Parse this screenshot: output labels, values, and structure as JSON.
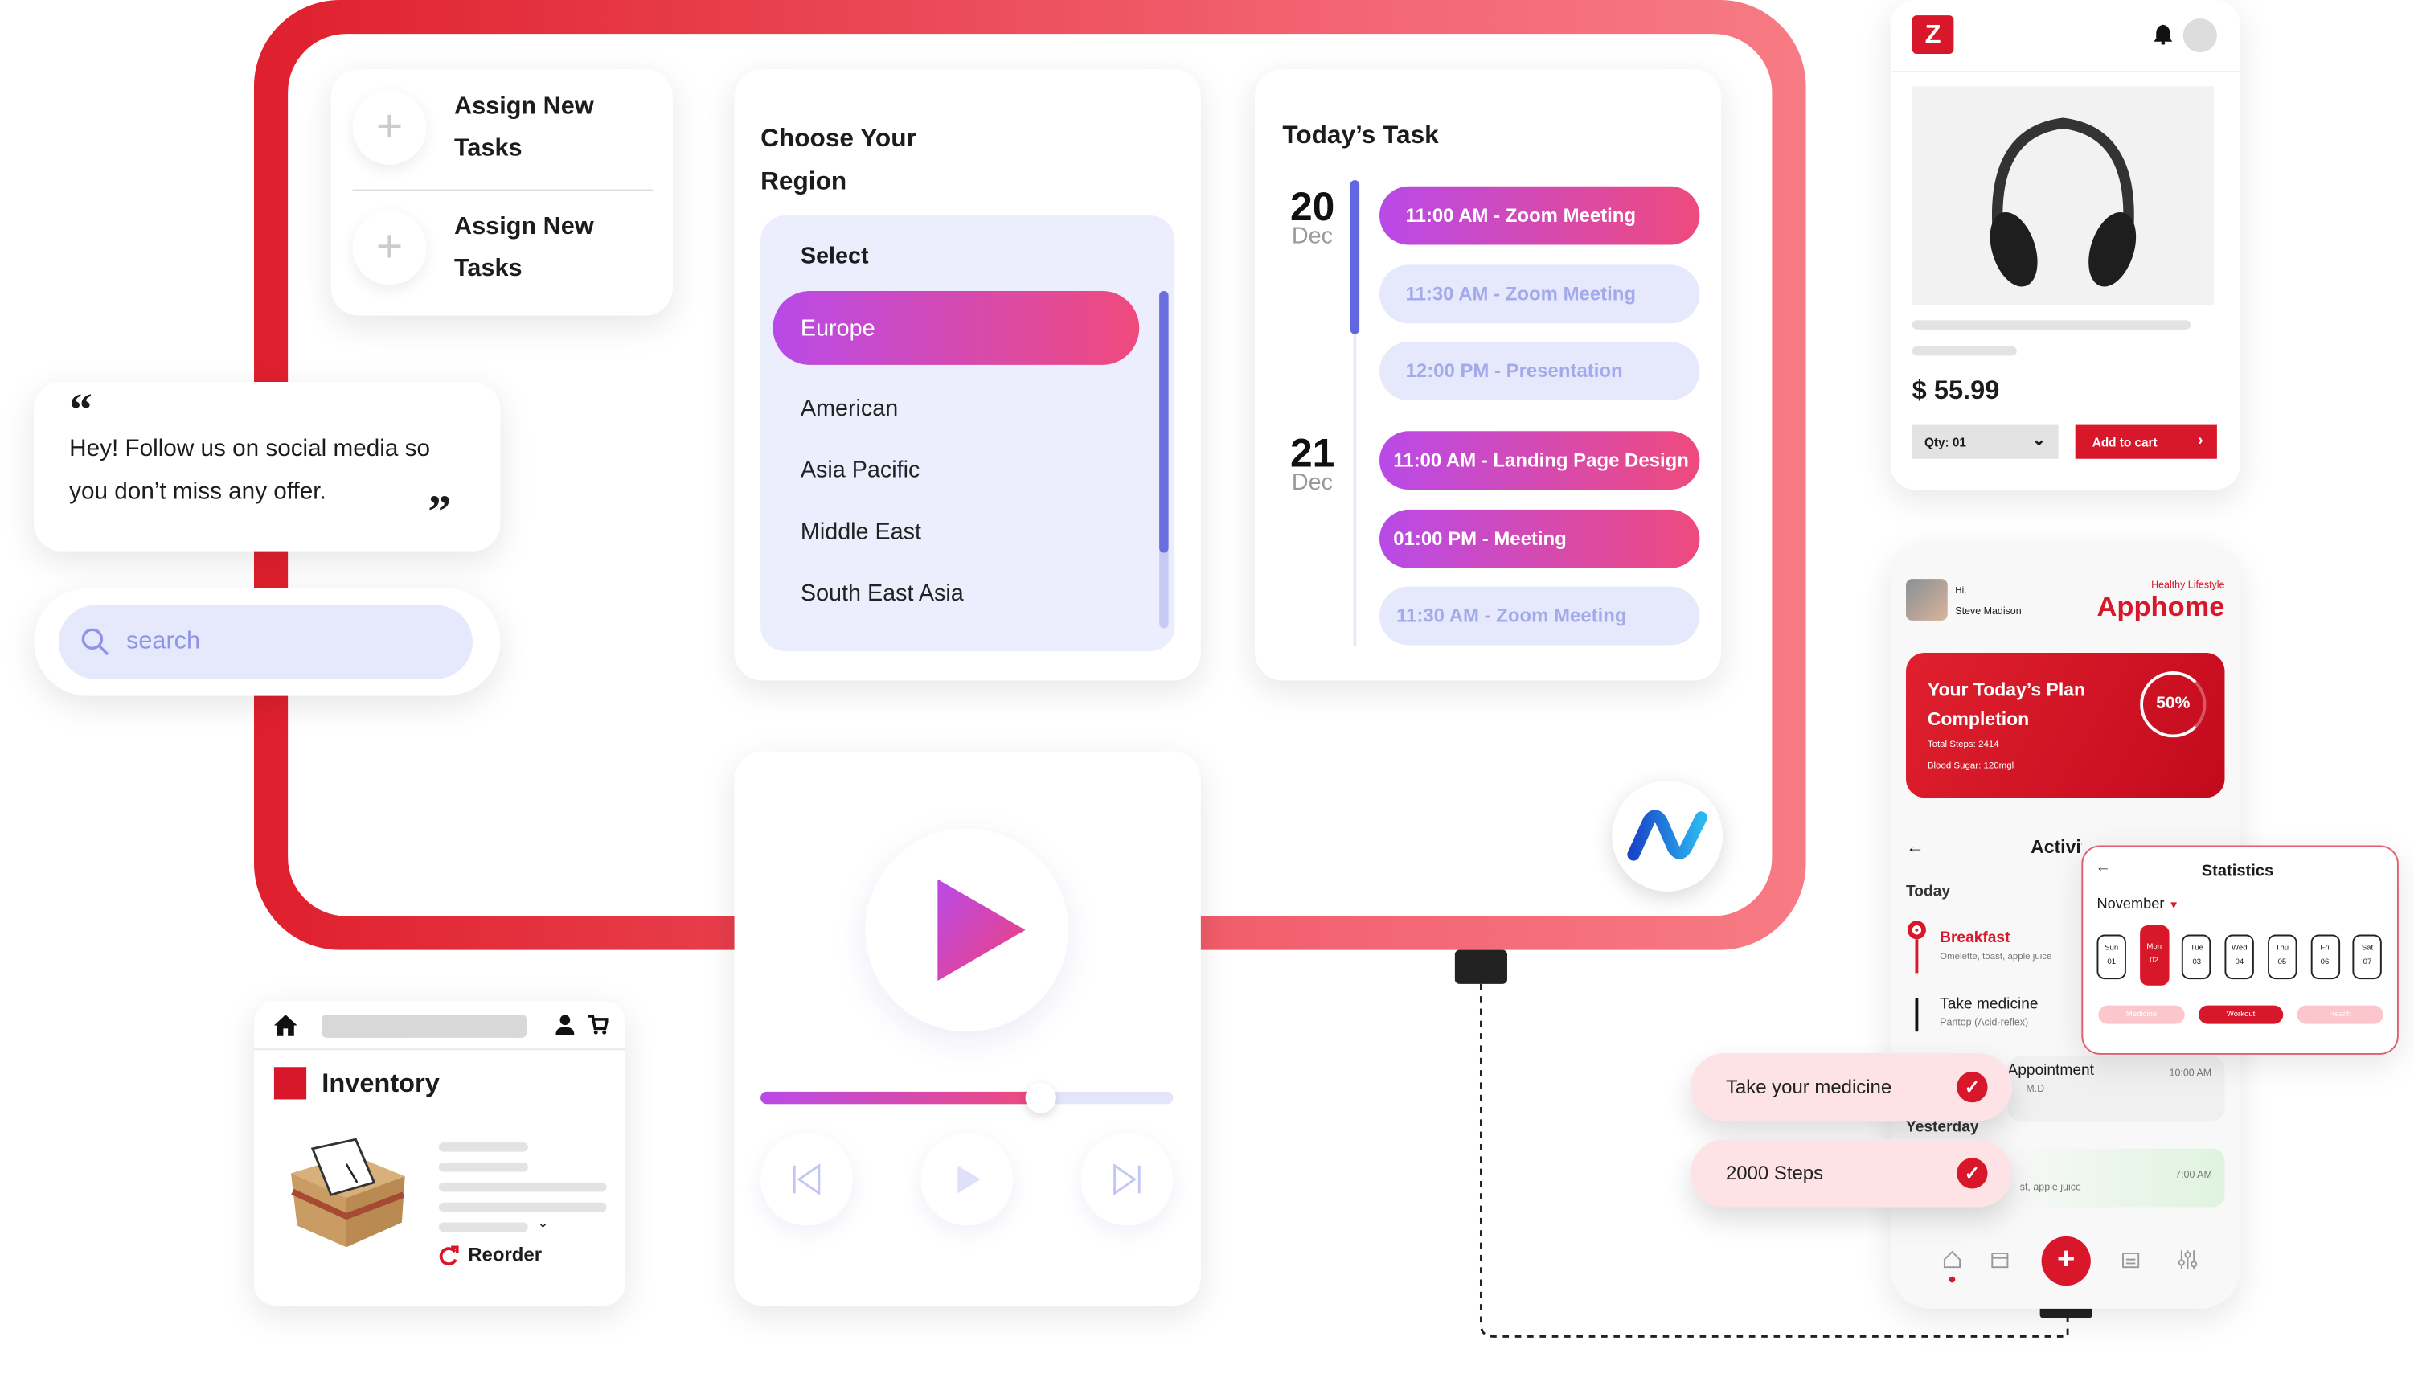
{
  "colors": {
    "brand_red": "#d9172a",
    "accent_purple": "#b94ae8",
    "accent_pink": "#ef4a7c",
    "indigo": "#6b6ee0",
    "lavender": "#e6e9fb"
  },
  "assign": {
    "items": [
      {
        "icon": "plus-icon",
        "label": "Assign New Tasks"
      },
      {
        "icon": "plus-icon",
        "label": "Assign New Tasks"
      }
    ]
  },
  "quote": {
    "open": "“",
    "text": "Hey! Follow us on social media so you don’t miss any offer.",
    "close": "”"
  },
  "search": {
    "placeholder": "search",
    "icon": "search-icon"
  },
  "region": {
    "title": "Choose Your Region",
    "header": "Select",
    "selected": "Europe",
    "options": [
      "American",
      "Asia Pacific",
      "Middle East",
      "South East Asia"
    ]
  },
  "tasks": {
    "title": "Today’s Task",
    "days": [
      {
        "day": "20",
        "month": "Dec",
        "items": [
          {
            "label": "11:00 AM - Zoom Meeting",
            "active": true
          },
          {
            "label": "11:30 AM - Zoom Meeting",
            "active": false
          },
          {
            "label": "12:00 PM - Presentation",
            "active": false
          }
        ]
      },
      {
        "day": "21",
        "month": "Dec",
        "items": [
          {
            "label": "11:00 AM - Landing Page Design",
            "active": true
          },
          {
            "label": "01:00 PM - Meeting",
            "active": true
          },
          {
            "label": "11:30 AM - Zoom Meeting",
            "active": false
          }
        ]
      }
    ]
  },
  "player": {
    "progress_percent": 68,
    "icons": [
      "play-icon",
      "previous-icon",
      "play-icon",
      "next-icon"
    ]
  },
  "inventory": {
    "title": "Inventory",
    "reorder": "Reorder",
    "icons": [
      "home-icon",
      "user-icon",
      "cart-icon",
      "reorder-icon"
    ]
  },
  "shop": {
    "logo": "Z",
    "price": "$ 55.99",
    "qty": "Qty: 01",
    "add_to_cart": "Add to cart"
  },
  "health": {
    "greeting": "Hi,",
    "user": "Steve Madison",
    "tagline": "Healthy Lifestyle",
    "brand": "Apphome",
    "plan": {
      "title": "Your Today’s Plan Completion",
      "percent": "50%",
      "steps": "Total Steps: 2414",
      "sugar": "Blood Sugar: 120mgl"
    },
    "activity_title": "Activity",
    "today": "Today",
    "yesterday": "Yesterday",
    "items": [
      {
        "title": "Breakfast",
        "sub": "Omelette, toast, apple juice"
      },
      {
        "title": "Take medicine",
        "sub": "Pantop (Acid-reflex)"
      },
      {
        "title": "Appointment",
        "sub": "- M.D",
        "time": "10:00 AM"
      },
      {
        "sub": "st, apple juice",
        "time": "7:00 AM"
      }
    ]
  },
  "stats": {
    "title": "Statistics",
    "month": "November",
    "days": [
      {
        "d": "Sun",
        "n": "01"
      },
      {
        "d": "Mon",
        "n": "02"
      },
      {
        "d": "Tue",
        "n": "03"
      },
      {
        "d": "Wed",
        "n": "04"
      },
      {
        "d": "Thu",
        "n": "05"
      },
      {
        "d": "Fri",
        "n": "06"
      },
      {
        "d": "Sat",
        "n": "07"
      }
    ],
    "tags": [
      "Medicine",
      "Workout",
      "Health"
    ],
    "selected_tag": "Workout",
    "selected_day": "Mon"
  },
  "pills": [
    {
      "label": "Take your medicine"
    },
    {
      "label": "2000 Steps"
    }
  ]
}
